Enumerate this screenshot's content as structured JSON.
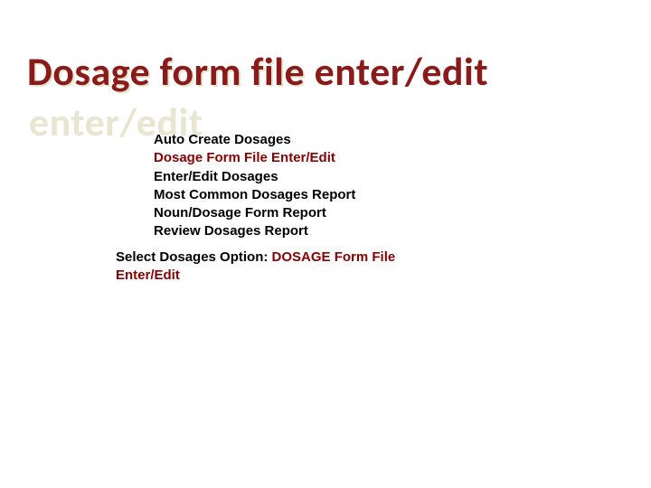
{
  "title": "Dosage form file enter/edit",
  "menu": {
    "items": [
      "Auto Create Dosages",
      "Dosage Form File Enter/Edit",
      "Enter/Edit Dosages",
      "Most Common Dosages Report",
      "Noun/Dosage Form Report",
      "Review Dosages Report"
    ],
    "highlight_index": 1
  },
  "prompt": {
    "label": "Select Dosages Option: ",
    "value": "DOSAGE Form File Enter/Edit"
  }
}
